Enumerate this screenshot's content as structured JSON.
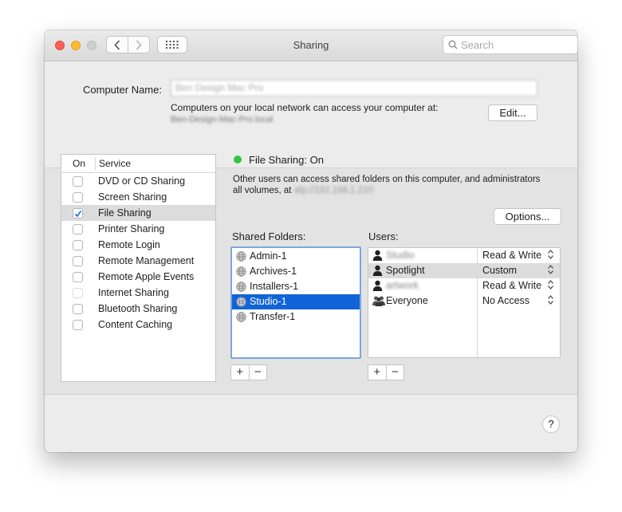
{
  "window": {
    "title": "Sharing"
  },
  "search": {
    "placeholder": "Search"
  },
  "computer_name": {
    "label": "Computer Name:",
    "value": "Ben Design Mac Pro",
    "network_text": "Computers on your local network can access your computer at:",
    "local_address": "Ben-Design-Mac-Pro.local",
    "edit_label": "Edit..."
  },
  "services": {
    "header_on": "On",
    "header_service": "Service",
    "items": [
      {
        "label": "DVD or CD Sharing",
        "checked": false,
        "selected": false,
        "dim": false
      },
      {
        "label": "Screen Sharing",
        "checked": false,
        "selected": false,
        "dim": false
      },
      {
        "label": "File Sharing",
        "checked": true,
        "selected": true,
        "dim": false
      },
      {
        "label": "Printer Sharing",
        "checked": false,
        "selected": false,
        "dim": false
      },
      {
        "label": "Remote Login",
        "checked": false,
        "selected": false,
        "dim": false
      },
      {
        "label": "Remote Management",
        "checked": false,
        "selected": false,
        "dim": false
      },
      {
        "label": "Remote Apple Events",
        "checked": false,
        "selected": false,
        "dim": false
      },
      {
        "label": "Internet Sharing",
        "checked": false,
        "selected": false,
        "dim": true
      },
      {
        "label": "Bluetooth Sharing",
        "checked": false,
        "selected": false,
        "dim": false
      },
      {
        "label": "Content Caching",
        "checked": false,
        "selected": false,
        "dim": false
      }
    ]
  },
  "file_sharing": {
    "status": "File Sharing: On",
    "status_color": "#30c641",
    "desc_line1": "Other users can access shared folders on this computer, and administrators",
    "desc_line2": "all volumes, at",
    "desc_addr": "afp://192.168.1.210",
    "options_label": "Options..."
  },
  "shared_folders": {
    "label": "Shared Folders:",
    "items": [
      "Admin-1",
      "Archives-1",
      "Installers-1",
      "Studio-1",
      "Transfer-1"
    ],
    "selected_index": 3
  },
  "users": {
    "label": "Users:",
    "items": [
      {
        "name": "Studio",
        "permission": "Read & Write",
        "icon": "person-icon",
        "blurred": true,
        "selected": false
      },
      {
        "name": "Spotlight",
        "permission": "Custom",
        "icon": "person-icon",
        "blurred": false,
        "selected": true
      },
      {
        "name": "artwork",
        "permission": "Read & Write",
        "icon": "person-icon",
        "blurred": true,
        "selected": false
      },
      {
        "name": "Everyone",
        "permission": "No Access",
        "icon": "group-icon",
        "blurred": false,
        "selected": false
      }
    ]
  },
  "controls": {
    "add": "+",
    "remove": "−",
    "help": "?"
  }
}
